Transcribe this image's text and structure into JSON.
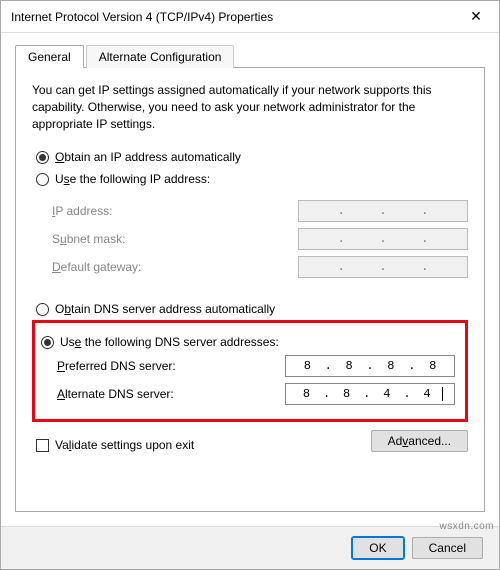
{
  "window": {
    "title": "Internet Protocol Version 4 (TCP/IPv4) Properties",
    "close_icon": "✕"
  },
  "tabs": {
    "general": "General",
    "alternate": "Alternate Configuration"
  },
  "description": "You can get IP settings assigned automatically if your network supports this capability. Otherwise, you need to ask your network administrator for the appropriate IP settings.",
  "ip": {
    "auto_label": "Obtain an IP address automatically",
    "manual_label": "Use the following IP address:",
    "address_label": "IP address:",
    "subnet_label": "Subnet mask:",
    "gateway_label": "Default gateway:"
  },
  "dns": {
    "auto_label": "Obtain DNS server address automatically",
    "manual_label": "Use the following DNS server addresses:",
    "pref_label": "Preferred DNS server:",
    "alt_label": "Alternate DNS server:",
    "pref": {
      "o1": "8",
      "o2": "8",
      "o3": "8",
      "o4": "8"
    },
    "alt": {
      "o1": "8",
      "o2": "8",
      "o3": "4",
      "o4": "4"
    }
  },
  "validate_label": "Validate settings upon exit",
  "advanced_label": "Advanced...",
  "buttons": {
    "ok": "OK",
    "cancel": "Cancel"
  },
  "watermark": "wsxdn.com"
}
